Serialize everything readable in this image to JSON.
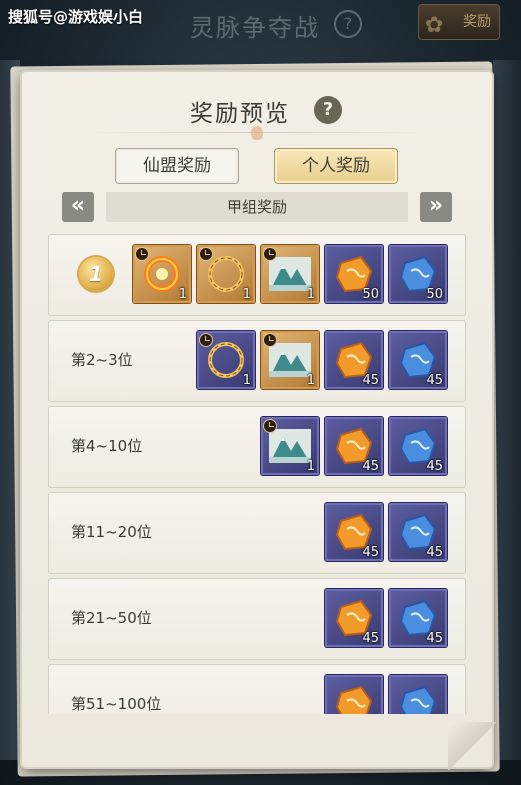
{
  "header": {
    "watermark": "搜狐号@游戏娱小白",
    "game_title": "灵脉争夺战",
    "help_icon": "?",
    "reward_button_label": "奖励"
  },
  "dialog": {
    "title": "奖励预览",
    "help_icon": "?",
    "tabs": [
      {
        "label": "仙盟奖励",
        "selected": false
      },
      {
        "label": "个人奖励",
        "selected": true
      }
    ],
    "nav_prev_icon": "«",
    "nav_next_icon": "»",
    "group_label": "甲组奖励",
    "rows": [
      {
        "rank": "1",
        "rank_is_medal": true,
        "items": [
          {
            "icon": "fire-ring-icon",
            "frame": "orange",
            "timed": true,
            "count": "1"
          },
          {
            "icon": "gold-ring-icon",
            "frame": "orange",
            "timed": true,
            "count": "1"
          },
          {
            "icon": "mountain-scroll-icon",
            "frame": "orange",
            "timed": true,
            "count": "1"
          },
          {
            "icon": "orange-spirit-stone-icon",
            "frame": "purple",
            "timed": false,
            "count": "50"
          },
          {
            "icon": "blue-spirit-stone-icon",
            "frame": "purple",
            "timed": false,
            "count": "50"
          }
        ]
      },
      {
        "rank": "第2~3位",
        "rank_is_medal": false,
        "items": [
          {
            "icon": "gold-ring-icon",
            "frame": "purple",
            "timed": true,
            "count": "1"
          },
          {
            "icon": "mountain-scroll-icon",
            "frame": "orange",
            "timed": true,
            "count": "1"
          },
          {
            "icon": "orange-spirit-stone-icon",
            "frame": "purple",
            "timed": false,
            "count": "45"
          },
          {
            "icon": "blue-spirit-stone-icon",
            "frame": "purple",
            "timed": false,
            "count": "45"
          }
        ]
      },
      {
        "rank": "第4~10位",
        "rank_is_medal": false,
        "items": [
          {
            "icon": "mountain-scroll-icon",
            "frame": "purple",
            "timed": true,
            "count": "1"
          },
          {
            "icon": "orange-spirit-stone-icon",
            "frame": "purple",
            "timed": false,
            "count": "45"
          },
          {
            "icon": "blue-spirit-stone-icon",
            "frame": "purple",
            "timed": false,
            "count": "45"
          }
        ]
      },
      {
        "rank": "第11~20位",
        "rank_is_medal": false,
        "items": [
          {
            "icon": "orange-spirit-stone-icon",
            "frame": "purple",
            "timed": false,
            "count": "45"
          },
          {
            "icon": "blue-spirit-stone-icon",
            "frame": "purple",
            "timed": false,
            "count": "45"
          }
        ]
      },
      {
        "rank": "第21~50位",
        "rank_is_medal": false,
        "items": [
          {
            "icon": "orange-spirit-stone-icon",
            "frame": "purple",
            "timed": false,
            "count": "45"
          },
          {
            "icon": "blue-spirit-stone-icon",
            "frame": "purple",
            "timed": false,
            "count": "45"
          }
        ]
      },
      {
        "rank": "第51~100位",
        "rank_is_medal": false,
        "items": [
          {
            "icon": "orange-spirit-stone-icon",
            "frame": "purple",
            "timed": false,
            "count": ""
          },
          {
            "icon": "blue-spirit-stone-icon",
            "frame": "purple",
            "timed": false,
            "count": ""
          }
        ]
      }
    ]
  },
  "colors": {
    "parchment": "#f1efe6",
    "tab_selected": "#e9cf8d",
    "frame_orange": "#c98a42",
    "frame_purple": "#4a4b88",
    "nav_button": "#8a8a84"
  }
}
